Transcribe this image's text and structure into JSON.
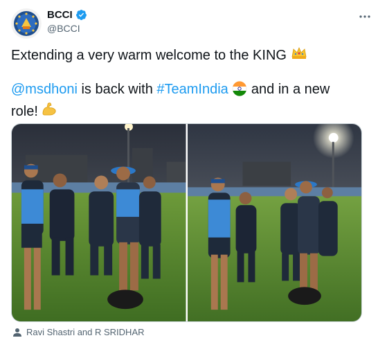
{
  "account": {
    "display_name": "BCCI",
    "handle": "@BCCI",
    "verified": true,
    "avatar_icon": "bcci-logo-icon"
  },
  "tweet": {
    "text_part1": "Extending a very warm welcome to the KING",
    "mention": "@msdhoni",
    "text_part2": " is back with ",
    "hashtag": "#TeamIndia",
    "text_part3": "and in a new",
    "text_part4": "role!",
    "emoji_crown": "crown-emoji-icon",
    "emoji_flag": "india-flag-emoji-icon",
    "emoji_muscle": "flexed-biceps-emoji-icon"
  },
  "media": {
    "photos": [
      {
        "subject": "team-training-photo-left"
      },
      {
        "subject": "team-training-photo-right"
      }
    ]
  },
  "tags": {
    "text": "Ravi Shastri and R SRIDHAR",
    "icon": "person-icon"
  },
  "colors": {
    "link": "#1d9bf0",
    "text": "#0f1419",
    "secondary": "#536471",
    "verified": "#1d9bf0"
  }
}
